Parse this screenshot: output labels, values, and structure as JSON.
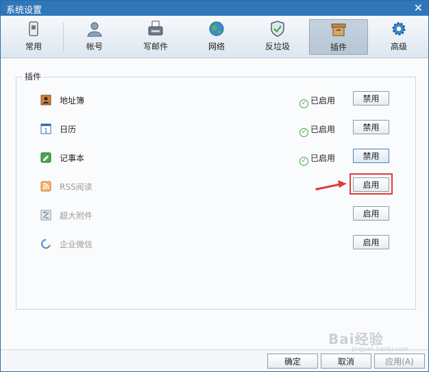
{
  "window": {
    "title": "系统设置",
    "close_icon": "close-icon"
  },
  "toolbar": {
    "tabs": [
      {
        "label": "常用",
        "icon": "phone-icon"
      },
      {
        "label": "帐号",
        "icon": "user-icon"
      },
      {
        "label": "写邮件",
        "icon": "compose-icon"
      },
      {
        "label": "网络",
        "icon": "globe-icon"
      },
      {
        "label": "反垃圾",
        "icon": "shield-icon"
      },
      {
        "label": "插件",
        "icon": "box-icon",
        "active": true
      },
      {
        "label": "高级",
        "icon": "gear-icon"
      }
    ]
  },
  "plugins": {
    "group_label": "插件",
    "items": [
      {
        "name": "地址簿",
        "icon": "address-book-icon",
        "status": "已启用",
        "button": "禁用",
        "enabled": true
      },
      {
        "name": "日历",
        "icon": "calendar-icon",
        "status": "已启用",
        "button": "禁用",
        "enabled": true
      },
      {
        "name": "记事本",
        "icon": "notepad-icon",
        "status": "已启用",
        "button": "禁用",
        "enabled": true
      },
      {
        "name": "RSS阅读",
        "icon": "rss-icon",
        "status": "",
        "button": "启用",
        "enabled": false
      },
      {
        "name": "超大附件",
        "icon": "attachment-icon",
        "status": "",
        "button": "启用",
        "enabled": false
      },
      {
        "name": "企业微信",
        "icon": "wework-icon",
        "status": "",
        "button": "启用",
        "enabled": false
      }
    ]
  },
  "footer": {
    "ok": "确定",
    "cancel": "取消",
    "apply": "应用(A)"
  },
  "watermark": {
    "text": "Bai经验",
    "sub": "jingyan.baidu.com"
  },
  "colors": {
    "titlebar": "#2f77b8",
    "highlight": "#e03a3a",
    "enabled_check": "#3aa53a"
  }
}
